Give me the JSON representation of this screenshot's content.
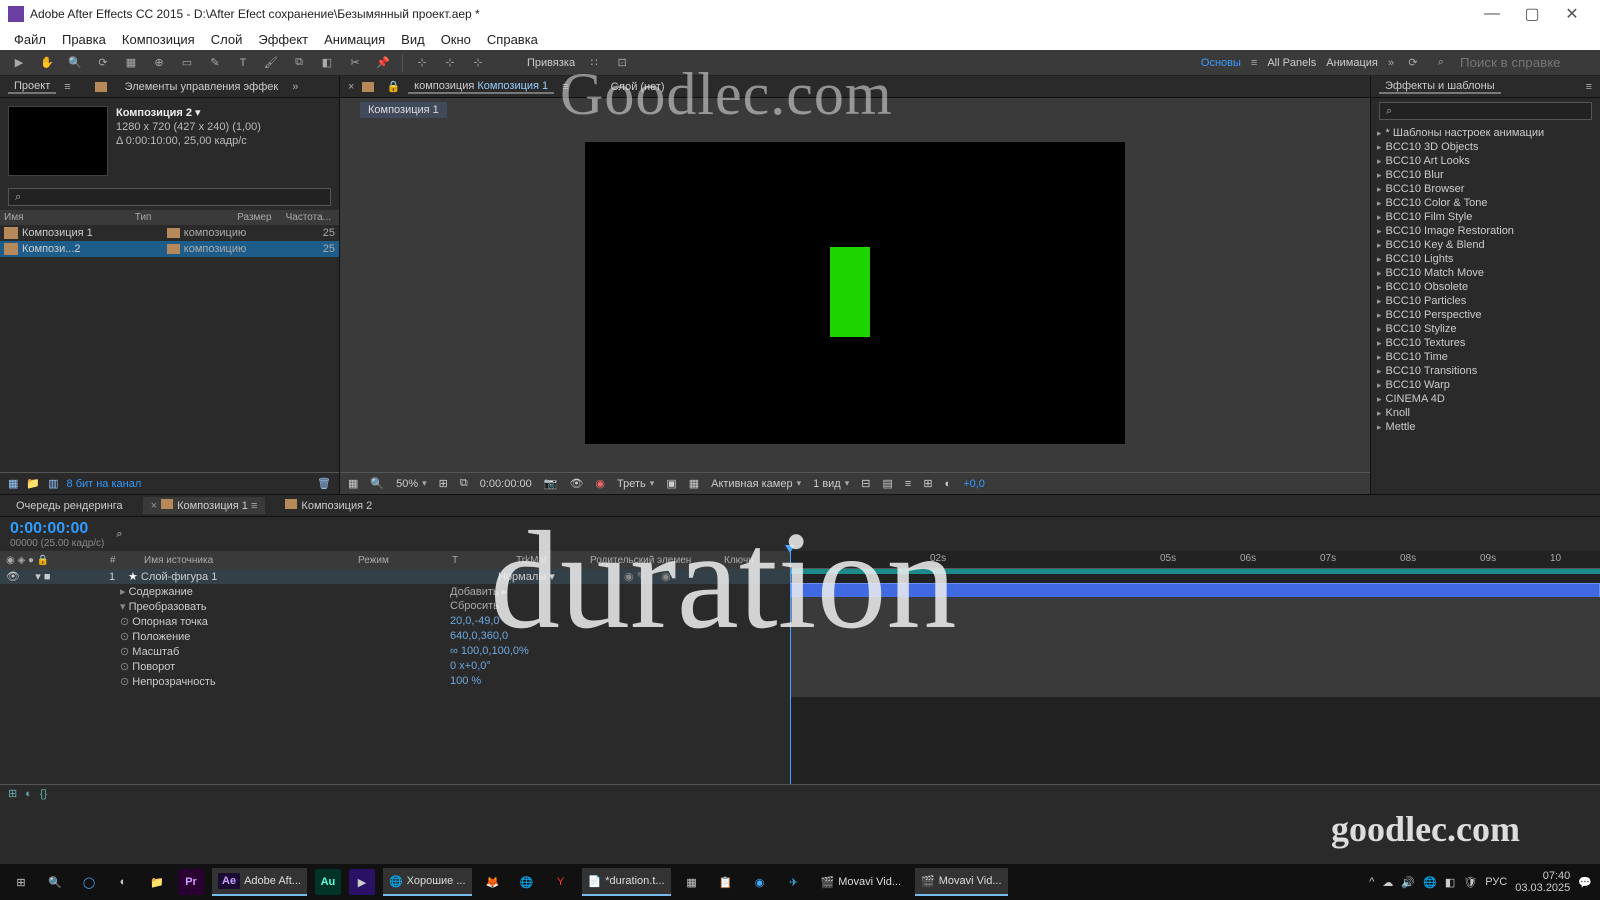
{
  "window": {
    "title": "Adobe After Effects CC 2015 - D:\\After Efect сохранение\\Безымянный проект.aep *"
  },
  "menu": [
    "Файл",
    "Правка",
    "Композиция",
    "Слой",
    "Эффект",
    "Анимация",
    "Вид",
    "Окно",
    "Справка"
  ],
  "toolbar": {
    "snap": "Привязка",
    "workspace_active": "Основы",
    "workspace_all": "All Panels",
    "workspace_anim": "Анимация",
    "search_ph": "Поиск в справке"
  },
  "project": {
    "tab1": "Проект",
    "tab2": "Элементы управления эффек",
    "comp_name": "Композиция 2",
    "comp_res": "1280 x 720  (427 x 240) (1,00)",
    "comp_dur": "Δ 0:00:10:00, 25,00 кадр/с",
    "search_ph": "⌕",
    "cols": {
      "name": "Имя",
      "type": "Тип",
      "size": "Размер",
      "freq": "Частота..."
    },
    "rows": [
      {
        "name": "Композиция 1",
        "type": "композицию",
        "fps": "25"
      },
      {
        "name": "Компози...2",
        "type": "композицию",
        "fps": "25"
      }
    ],
    "footer_bits": "8 бит на канал"
  },
  "viewer": {
    "tab_prefix": "композиция",
    "tab_comp": "Композиция 1",
    "tab_layer": "Слой  (нет)",
    "chip": "Композиция 1",
    "zoom": "50%",
    "time": "0:00:00:00",
    "res": "Треть",
    "camera": "Активная камер",
    "views": "1 вид",
    "exposure": "+0,0"
  },
  "effects": {
    "title": "Эффекты и шаблоны",
    "search": "⌕",
    "items": [
      "* Шаблоны настроек анимации",
      "BCC10 3D Objects",
      "BCC10 Art Looks",
      "BCC10 Blur",
      "BCC10 Browser",
      "BCC10 Color & Tone",
      "BCC10 Film Style",
      "BCC10 Image Restoration",
      "BCC10 Key & Blend",
      "BCC10 Lights",
      "BCC10 Match Move",
      "BCC10 Obsolete",
      "BCC10 Particles",
      "BCC10 Perspective",
      "BCC10 Stylize",
      "BCC10 Textures",
      "BCC10 Time",
      "BCC10 Transitions",
      "BCC10 Warp",
      "CINEMA 4D",
      "Knoll",
      "Mettle"
    ]
  },
  "timeline": {
    "tab_render": "Очередь рендеринга",
    "tab_comp1": "Композиция 1",
    "tab_comp2": "Композиция 2",
    "time": "0:00:00:00",
    "fps": "00000 (25.00 кадр/с)",
    "cols": {
      "src": "Имя источника",
      "mode": "Режим",
      "trkmat": "TrkMat",
      "parent": "Родительский элемен",
      "keys": "Ключи"
    },
    "layer": {
      "idx": "1",
      "name": "Слой-фигура 1",
      "mode": "Нормалы"
    },
    "group1": "Содержание",
    "group2": "Преобразовать",
    "props": [
      {
        "name": "Опорная точка",
        "val": "20,0,-49,0"
      },
      {
        "name": "Положение",
        "val": "640,0,360,0"
      },
      {
        "name": "Масштаб",
        "val": "∞ 100,0,100,0%"
      },
      {
        "name": "Поворот",
        "val": "0 x+0,0°"
      },
      {
        "name": "Непрозрачность",
        "val": "100 %"
      }
    ],
    "ruler": [
      "02s",
      "05s",
      "06s",
      "07s",
      "08s",
      "09s",
      "10"
    ]
  },
  "taskbar": {
    "apps": [
      {
        "label": "Adobe Aft...",
        "active": true
      },
      {
        "label": "Хорошие ...",
        "active": true
      },
      {
        "label": "*duration.t...",
        "active": true
      },
      {
        "label": "Movavi Vid...",
        "active": false
      },
      {
        "label": "Movavi Vid...",
        "active": true
      }
    ],
    "lang": "РУС",
    "time": "07:40",
    "date": "03.03.2025"
  },
  "watermarks": {
    "top": "Goodlec.com",
    "mid": "duration",
    "bottom": "goodlec.com"
  }
}
